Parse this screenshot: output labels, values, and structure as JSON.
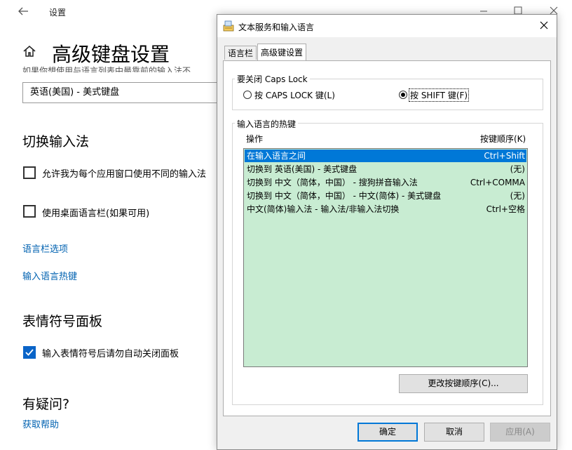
{
  "settings": {
    "window_title": "设置",
    "page_title": "高级键盘设置",
    "cut_text": "如果你想使用与语言列表中最靠前的输入法不",
    "input_combo_value": "英语(美国) - 美式键盘",
    "section_switch": "切换输入法",
    "checkbox_per_app": "允许我为每个应用窗口使用不同的输入法",
    "checkbox_langbar": "使用桌面语言栏(如果可用)",
    "link_langbar_options": "语言栏选项",
    "link_hotkeys": "输入语言热键",
    "section_emoji": "表情符号面板",
    "checkbox_emoji": "输入表情符号后请勿自动关闭面板",
    "section_question": "有疑问?",
    "link_help": "获取帮助"
  },
  "dialog": {
    "title": "文本服务和输入语言",
    "tabs": [
      {
        "label": "语言栏"
      },
      {
        "label": "高级键设置"
      }
    ],
    "caps_group_label": "要关闭 Caps Lock",
    "radio_caps": "按 CAPS LOCK 键(L)",
    "radio_shift": "按 SHIFT 键(F)",
    "hotkey_group_label": "输入语言的热键",
    "col_action": "操作",
    "col_key": "按键顺序(K)",
    "rows": [
      {
        "action": "在输入语言之间",
        "key": "Ctrl+Shift"
      },
      {
        "action": "切换到 英语(美国) - 美式键盘",
        "key": "(无)"
      },
      {
        "action": "切换到 中文（简体，中国） - 搜狗拼音输入法",
        "key": "Ctrl+COMMA"
      },
      {
        "action": "切换到 中文（简体，中国） - 中文(简体) - 美式键盘",
        "key": "(无)"
      },
      {
        "action": "中文(简体)输入法 - 输入法/非输入法切换",
        "key": "Ctrl+空格"
      }
    ],
    "change_button": "更改按键顺序(C)...",
    "ok_button": "确定",
    "cancel_button": "取消",
    "apply_button": "应用(A)"
  },
  "colors": {
    "accent": "#0078d7",
    "link": "#0062b1",
    "list_bg": "#c8ecd2"
  }
}
